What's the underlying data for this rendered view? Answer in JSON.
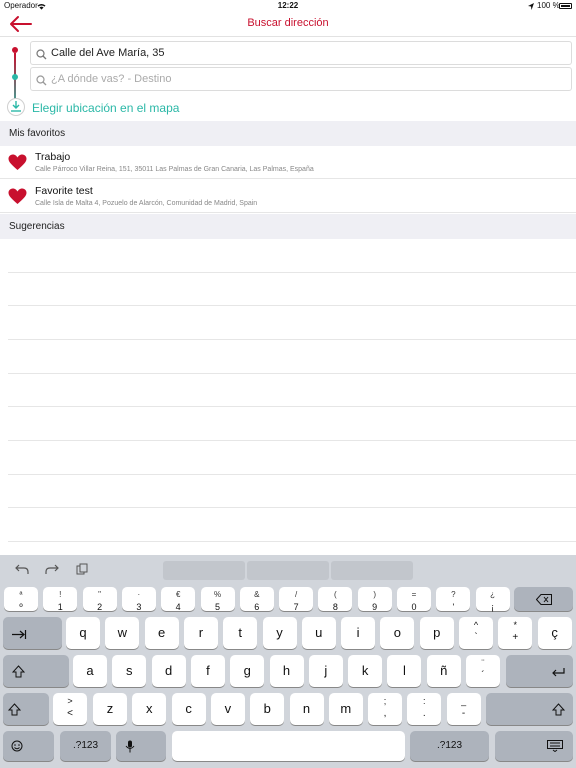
{
  "status": {
    "carrier": "Operador",
    "time": "12:22",
    "battery": "100 %"
  },
  "nav": {
    "title": "Buscar dirección"
  },
  "route": {
    "origin_value": "Calle del Ave María, 35",
    "destination_placeholder": "¿A dónde vas? - Destino"
  },
  "map_button": "Elegir ubicación en el mapa",
  "favorites": {
    "header": "Mis favoritos",
    "items": [
      {
        "title": "Trabajo",
        "address": "Calle Párroco Villar Reina, 151, 35011 Las Palmas de Gran Canaria, Las Palmas, España"
      },
      {
        "title": "Favorite test",
        "address": "Calle Isla de Malta 4, Pozuelo de Alarcón, Comunidad de Madrid, Spain"
      }
    ]
  },
  "suggestions": {
    "header": "Sugerencias"
  },
  "colors": {
    "accent_red": "#c8102e",
    "accent_teal": "#2bb8a7"
  },
  "keyboard": {
    "row0": [
      {
        "t": "ª",
        "b": "º"
      },
      {
        "t": "!",
        "b": "1"
      },
      {
        "t": "\"",
        "b": "2"
      },
      {
        "t": "·",
        "b": "3"
      },
      {
        "t": "€",
        "b": "4"
      },
      {
        "t": "%",
        "b": "5"
      },
      {
        "t": "&",
        "b": "6"
      },
      {
        "t": "/",
        "b": "7"
      },
      {
        "t": "(",
        "b": "8"
      },
      {
        "t": ")",
        "b": "9"
      },
      {
        "t": "=",
        "b": "0"
      },
      {
        "t": "?",
        "b": "'"
      },
      {
        "t": "¿",
        "b": "¡"
      }
    ],
    "row1": [
      "q",
      "w",
      "e",
      "r",
      "t",
      "y",
      "u",
      "i",
      "o",
      "p"
    ],
    "row1_extra": [
      {
        "t": "^",
        "b": "`"
      },
      {
        "t": "*",
        "b": "+"
      },
      {
        "t": "",
        "b": "ç"
      }
    ],
    "row2": [
      "a",
      "s",
      "d",
      "f",
      "g",
      "h",
      "j",
      "k",
      "l",
      "ñ"
    ],
    "row2_extra": {
      "t": "¨",
      "b": "´"
    },
    "row3_first": {
      "t": ">",
      "b": "<"
    },
    "row3": [
      "z",
      "x",
      "c",
      "v",
      "b",
      "n",
      "m"
    ],
    "row3_extra": [
      {
        "t": ";",
        "b": ","
      },
      {
        "t": ":",
        "b": "."
      },
      {
        "t": "_",
        "b": "-"
      }
    ],
    "numbers_label": ".?123"
  }
}
